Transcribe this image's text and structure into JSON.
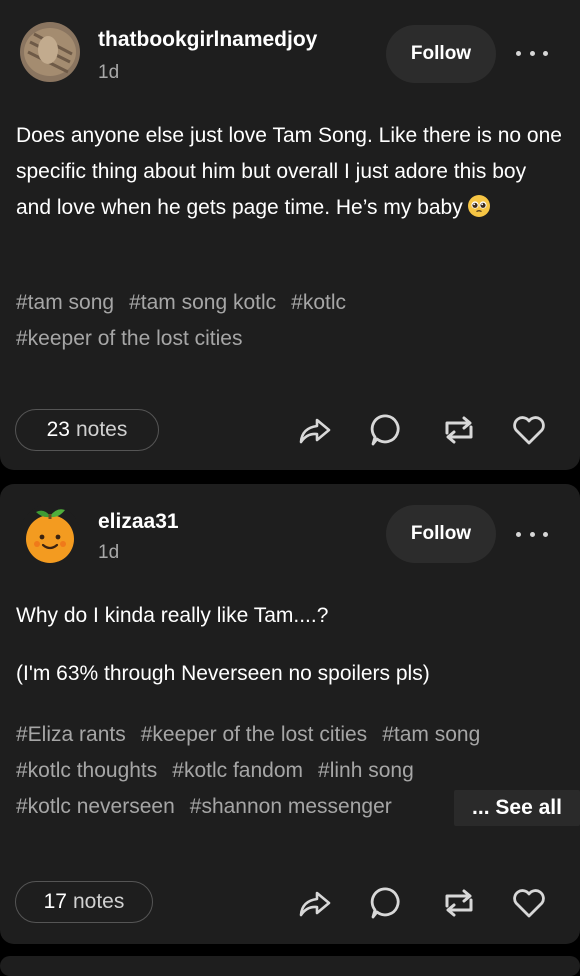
{
  "posts": [
    {
      "username": "thatbookgirlnamedjoy",
      "time": "1d",
      "follow_label": "Follow",
      "body": [
        "Does anyone else just love Tam Song. Like there is no one specific thing about him but overall I just adore this boy and love when he gets page time. He’s my baby"
      ],
      "emoji_icon": "pleading-face-emoji",
      "tags": [
        "#tam song",
        "#tam song kotlc",
        "#kotlc",
        "#keeper of the lost cities"
      ],
      "notes_count": "23",
      "notes_label": "notes"
    },
    {
      "username": "elizaa31",
      "time": "1d",
      "follow_label": "Follow",
      "body": [
        "Why do I kinda really like Tam....?",
        "(I'm 63% through Neverseen no spoilers pls)"
      ],
      "tags": [
        "#Eliza rants",
        "#keeper of the lost cities",
        "#tam song",
        "#kotlc thoughts",
        "#kotlc fandom",
        "#linh song",
        "#kotlc neverseen",
        "#shannon messenger"
      ],
      "see_all_label": "... See all",
      "notes_count": "17",
      "notes_label": "notes"
    }
  ],
  "icons": {
    "share": "share-icon",
    "reply": "reply-icon",
    "reblog": "reblog-icon",
    "like": "heart-icon",
    "more": "more-options-icon"
  },
  "colors": {
    "background": "#000000",
    "card": "#1e1e1e",
    "follow_button": "#2c2c2c",
    "tag_text": "#a6a6a6",
    "muted_text": "#a8a8a8"
  }
}
